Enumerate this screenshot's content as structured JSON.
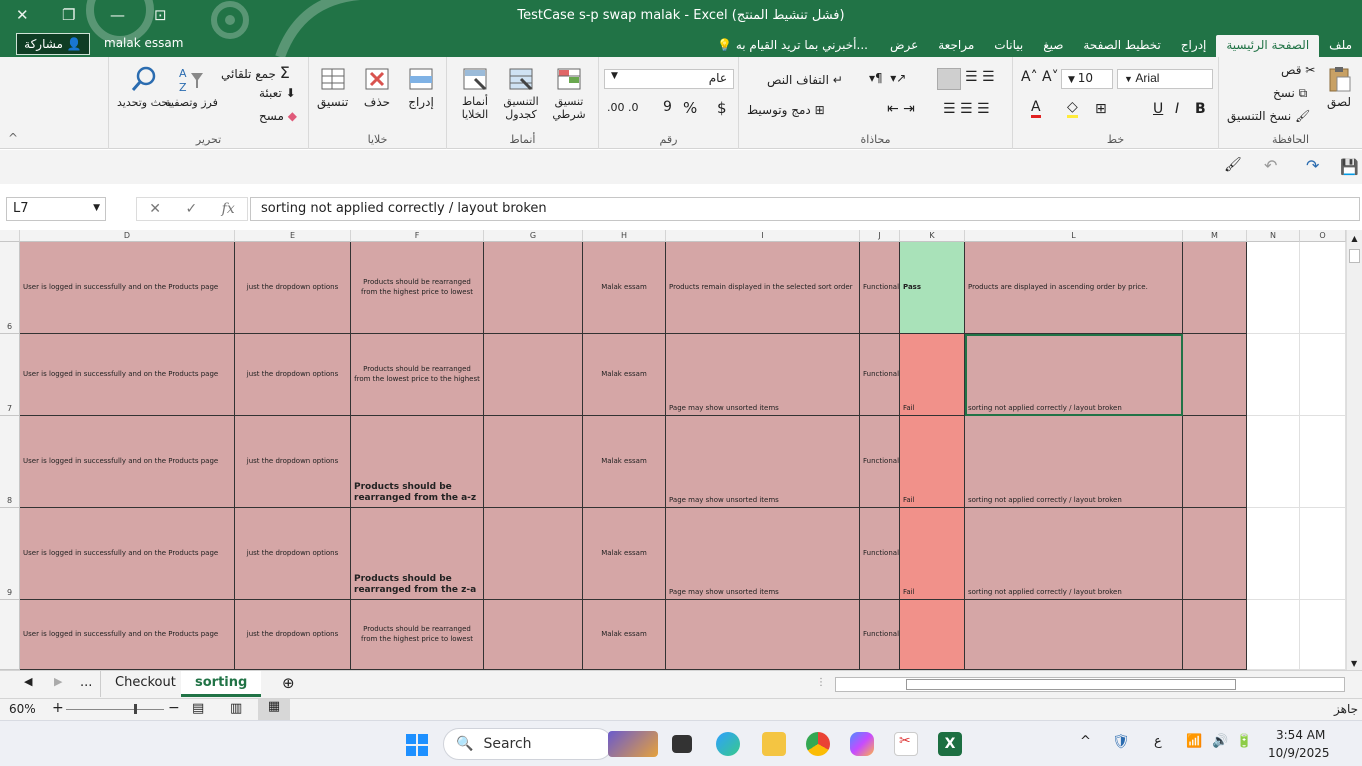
{
  "window": {
    "title": "TestCase s-p swap malak - Excel (فشل تنشيط المنتج)",
    "share_label": "مشاركة",
    "user_name": "malak essam"
  },
  "ribbon_tabs": [
    "ملف",
    "الصفحة الرئيسية",
    "إدراج",
    "تخطيط الصفحة",
    "صيغ",
    "بيانات",
    "مراجعة",
    "عرض"
  ],
  "tell_me": "أخبرني بما تريد القيام به...",
  "ribbon": {
    "clipboard": {
      "label": "الحافظة",
      "paste": "لصق",
      "cut": "قص",
      "copy": "نسخ",
      "format_painter": "نسخ التنسيق"
    },
    "font": {
      "label": "خط",
      "name": "Arial",
      "size": "10",
      "bold": "B",
      "italic": "I",
      "underline": "U"
    },
    "alignment": {
      "label": "محاذاة",
      "wrap": "التفاف النص",
      "merge": "دمج وتوسيط"
    },
    "number": {
      "label": "رقم",
      "format": "عام",
      "currency": "$",
      "percent": "%",
      "comma": "9"
    },
    "styles": {
      "label": "أنماط",
      "conditional": "تنسيق شرطي",
      "as_table": "التنسيق كجدول",
      "cell_styles": "أنماط الخلايا"
    },
    "cells": {
      "label": "خلايا",
      "insert": "إدراج",
      "delete": "حذف",
      "format": "تنسيق"
    },
    "editing": {
      "label": "تحرير",
      "autosum": "جمع تلقائي",
      "fill": "تعبئة",
      "clear": "مسح",
      "sort": "فرز وتصفية",
      "find": "بحث وتحديد"
    }
  },
  "formula_bar": {
    "name_box": "L7",
    "fx": "fx",
    "formula": "sorting not applied correctly / layout broken"
  },
  "columns": [
    "D",
    "E",
    "F",
    "G",
    "H",
    "I",
    "J",
    "K",
    "L",
    "M",
    "N",
    "O"
  ],
  "rows": [
    {
      "num": "6",
      "D": "User is logged in successfully and on the Products page",
      "E": "just the dropdown options",
      "F": "Products should be rearranged from the highest price to lowest",
      "H": "Malak essam",
      "I": "Products remain displayed in the selected sort order",
      "J": "Functional",
      "K": "Pass",
      "L": "Products are displayed in ascending order by price."
    },
    {
      "num": "7",
      "D": "User is logged in successfully and on the Products page",
      "E": "just the dropdown options",
      "F": "Products should be rearranged from the lowest price to the highest",
      "H": "Malak essam",
      "I": "Page may show unsorted items",
      "J": "Functional",
      "K": "Fail",
      "L": "sorting not applied correctly / layout broken"
    },
    {
      "num": "8",
      "D": "User is logged in successfully and on the Products page",
      "E": "just the dropdown options",
      "F": "Products should be rearranged from the a-z",
      "H": "Malak essam",
      "I": "Page may show unsorted items",
      "J": "Functional",
      "K": "Fail",
      "L": "sorting not applied correctly / layout broken"
    },
    {
      "num": "9",
      "D": "User is logged in successfully and on the Products page",
      "E": "just the dropdown options",
      "F": "Products should be rearranged from the z-a",
      "H": "Malak essam",
      "I": "Page may show unsorted items",
      "J": "Functional",
      "K": "Fail",
      "L": "sorting not applied correctly / layout broken"
    },
    {
      "num": "",
      "D": "User is logged in successfully and on the Products page",
      "E": "just the dropdown options",
      "F": "Products should be rearranged from the highest price to lowest",
      "H": "Malak essam",
      "I": "",
      "J": "Functional",
      "K": "",
      "L": ""
    }
  ],
  "sheets": {
    "more": "...",
    "checkout": "Checkout",
    "sorting": "sorting"
  },
  "status": {
    "zoom": "60%",
    "ready": "جاهز"
  },
  "taskbar": {
    "search": "Search",
    "time": "3:54 AM",
    "date": "10/9/2025",
    "lang": "ع"
  }
}
